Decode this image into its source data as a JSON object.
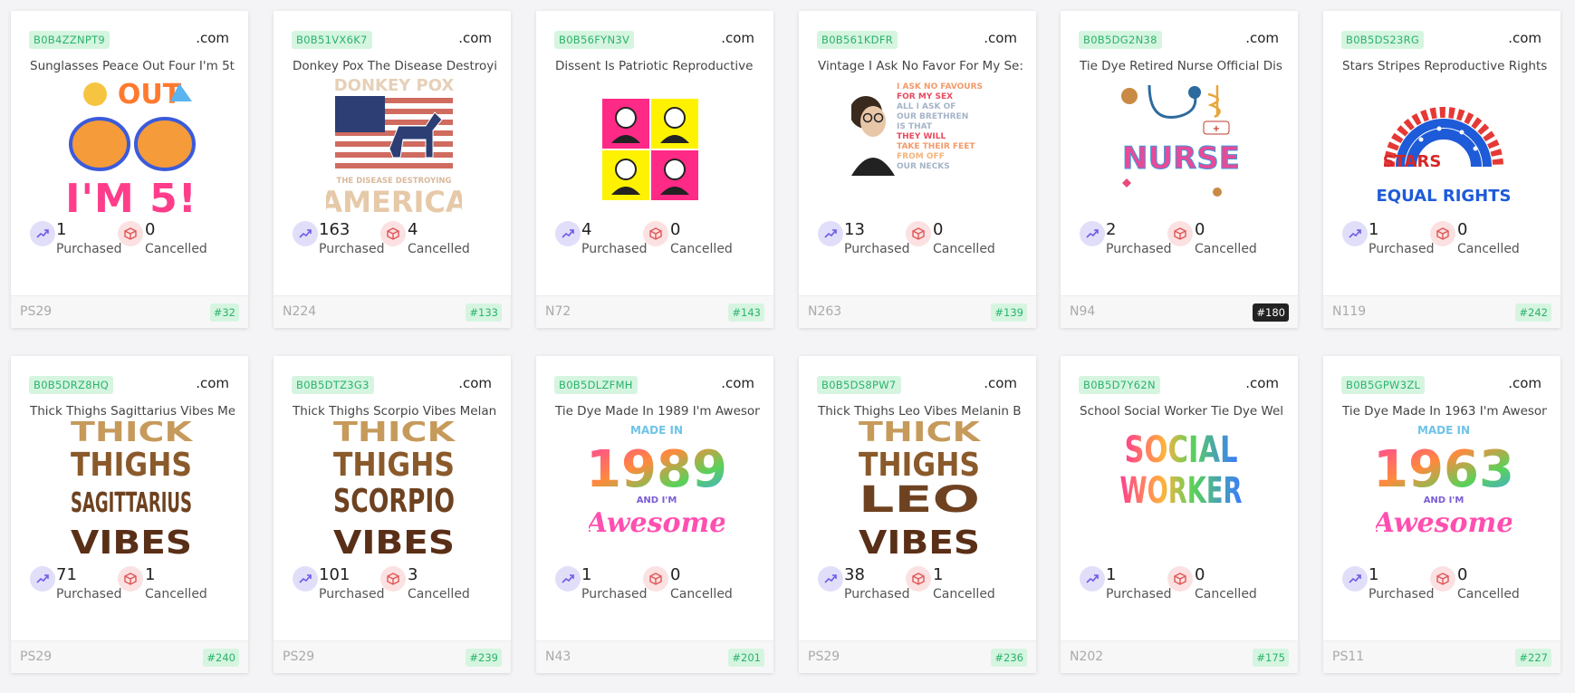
{
  "labels": {
    "purchased": "Purchased",
    "cancelled": "Cancelled",
    "domain": ".com"
  },
  "colors": {
    "badge_green_bg": "#d6f5e1",
    "badge_green_text": "#2bb36a",
    "rank_dark": "#222222"
  },
  "products": [
    {
      "asin": "B0B4ZZNPT9",
      "title": "Sunglasses Peace Out Four I'm 5t",
      "purchased": "1",
      "cancelled": "0",
      "code": "PS29",
      "rank": "#32",
      "art": "peace"
    },
    {
      "asin": "B0B51VX6K7",
      "title": "Donkey Pox The Disease Destroyi",
      "purchased": "163",
      "cancelled": "4",
      "code": "N224",
      "rank": "#133",
      "art": "donkey"
    },
    {
      "asin": "B0B56FYN3V",
      "title": "Dissent Is Patriotic Reproductive",
      "purchased": "4",
      "cancelled": "0",
      "code": "N72",
      "rank": "#143",
      "art": "quad"
    },
    {
      "asin": "B0B561KDFR",
      "title": "Vintage I Ask No Favor For My Se:",
      "purchased": "13",
      "cancelled": "0",
      "code": "N263",
      "rank": "#139",
      "art": "quote"
    },
    {
      "asin": "B0B5DG2N38",
      "title": "Tie Dye Retired Nurse Official Dis",
      "purchased": "2",
      "cancelled": "0",
      "code": "N94",
      "rank": "#180",
      "rank_dark": true,
      "art": "nurse"
    },
    {
      "asin": "B0B5DS23RG",
      "title": "Stars Stripes Reproductive Rights",
      "purchased": "1",
      "cancelled": "0",
      "code": "N119",
      "rank": "#242",
      "art": "rainbow"
    },
    {
      "asin": "B0B5DRZ8HQ",
      "title": "Thick Thighs Sagittarius Vibes Me",
      "purchased": "71",
      "cancelled": "1",
      "code": "PS29",
      "rank": "#240",
      "art": "thick-sag"
    },
    {
      "asin": "B0B5DTZ3G3",
      "title": "Thick Thighs Scorpio Vibes Melan",
      "purchased": "101",
      "cancelled": "3",
      "code": "PS29",
      "rank": "#239",
      "art": "thick-scorpio"
    },
    {
      "asin": "B0B5DLZFMH",
      "title": "Tie Dye Made In 1989 I'm Awesom",
      "purchased": "1",
      "cancelled": "0",
      "code": "N43",
      "rank": "#201",
      "art": "made1989"
    },
    {
      "asin": "B0B5DS8PW7",
      "title": "Thick Thighs Leo Vibes Melanin B",
      "purchased": "38",
      "cancelled": "1",
      "code": "PS29",
      "rank": "#236",
      "art": "thick-leo"
    },
    {
      "asin": "B0B5D7Y62N",
      "title": "School Social Worker Tie Dye Wel",
      "purchased": "1",
      "cancelled": "0",
      "code": "N202",
      "rank": "#175",
      "art": "social"
    },
    {
      "asin": "B0B5GPW3ZL",
      "title": "Tie Dye Made In 1963 I'm Awesom",
      "purchased": "1",
      "cancelled": "0",
      "code": "PS11",
      "rank": "#227",
      "art": "made1963"
    }
  ],
  "art_text": {
    "peace": [
      "OUT",
      "I'M 5!"
    ],
    "donkey": [
      "DONKEY POX",
      "THE DISEASE DESTROYING",
      "AMERICA"
    ],
    "quote": [
      "I ASK NO FAVOURS",
      "FOR MY SEX",
      "ALL I ASK OF",
      "OUR BRETHREN",
      "IS THAT",
      "THEY WILL",
      "TAKE THEIR FEET",
      "FROM OFF",
      "OUR NECKS"
    ],
    "nurse": [
      "NURSE"
    ],
    "rainbow": [
      "STARS",
      "EQUAL RIGHTS"
    ],
    "thick-sag": [
      "THICK",
      "THIGHS",
      "SAGITTARIUS",
      "VIBES"
    ],
    "thick-scorpio": [
      "THICK",
      "THIGHS",
      "SCORPIO",
      "VIBES"
    ],
    "thick-leo": [
      "THICK",
      "THIGHS",
      "LEO",
      "VIBES"
    ],
    "made1989": [
      "MADE IN",
      "1989",
      "AND I'M",
      "Awesome"
    ],
    "made1963": [
      "MADE IN",
      "1963",
      "AND I'M",
      "Awesome"
    ],
    "social": [
      "SOCIAL",
      "WORKER"
    ]
  }
}
